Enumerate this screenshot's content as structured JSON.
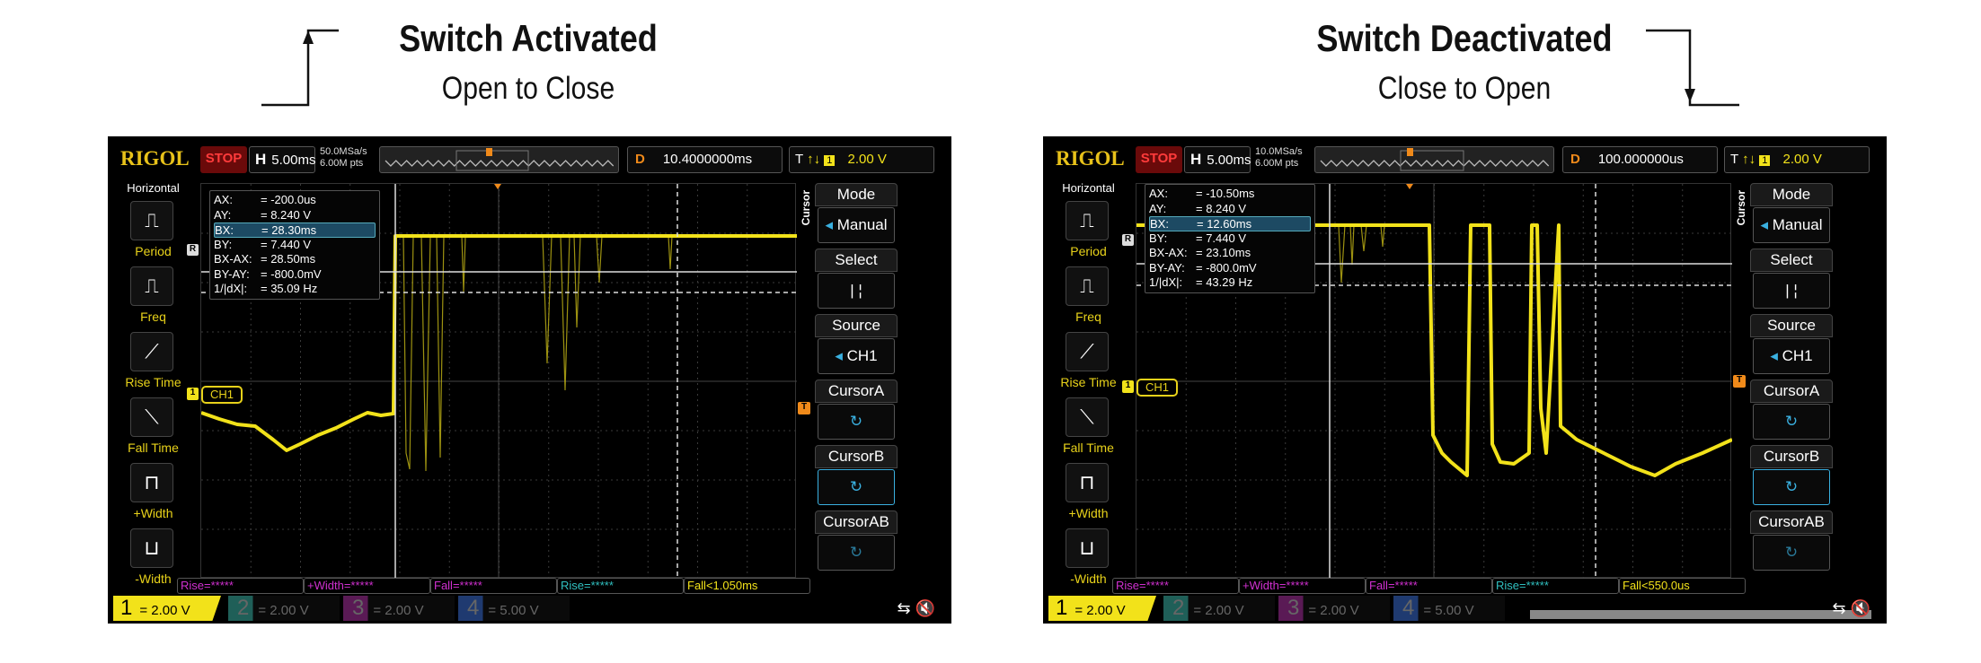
{
  "annotations": [
    {
      "title": "Switch Activated",
      "subtitle": "Open to Close",
      "arrow": "up"
    },
    {
      "title": "Switch Deactivated",
      "subtitle": "Close to Open",
      "arrow": "down"
    }
  ],
  "colors": {
    "ch1": "#f2e21a",
    "ch2": "#2a9d8f",
    "ch3": "#b0309a",
    "ch4": "#2a5db0",
    "cursor_accent": "#3ab0e0",
    "trigger": "#f08a1a",
    "stop": "#ff3b3b"
  },
  "scopes": [
    {
      "brand": "RIGOL",
      "run_state": "STOP",
      "timebase_label": "H",
      "timebase": "5.00ms",
      "sample_rate": "50.0MSa/s",
      "memory_depth": "6.00M pts",
      "delay_label": "D",
      "delay": "10.4000000ms",
      "trigger_label": "T",
      "trigger_icons": "↑↓",
      "trigger_channel": "1",
      "trigger_level": "2.00 V",
      "left_menu": {
        "title": "Horizontal",
        "items": [
          {
            "label": "Period",
            "icon": "period-icon"
          },
          {
            "label": "Freq",
            "icon": "freq-icon"
          },
          {
            "label": "Rise Time",
            "icon": "rise-time-icon"
          },
          {
            "label": "Fall Time",
            "icon": "fall-time-icon"
          },
          {
            "label": "+Width",
            "icon": "positive-width-icon"
          },
          {
            "label": "-Width",
            "icon": "negative-width-icon"
          }
        ]
      },
      "cursor_readout": [
        {
          "k": "AX:",
          "v": "= -200.0us"
        },
        {
          "k": "AY:",
          "v": "= 8.240 V"
        },
        {
          "k": "BX:",
          "v": "= 28.30ms",
          "selected": true
        },
        {
          "k": "BY:",
          "v": "= 7.440 V"
        },
        {
          "k": "BX-AX:",
          "v": "= 28.50ms"
        },
        {
          "k": "BY-AY:",
          "v": "= -800.0mV"
        },
        {
          "k": "1/|dX|:",
          "v": "= 35.09 Hz"
        }
      ],
      "right_menu": {
        "section": "Cursor",
        "mode_label": "Mode",
        "mode": "Manual",
        "select_label": "Select",
        "select": "|  ¦",
        "source_label": "Source",
        "source": "CH1",
        "cursor_a_label": "CursorA",
        "cursor_a": "-200.0us",
        "cursor_b_label": "CursorB",
        "cursor_b": "28.30ms",
        "cursor_ab_label": "CursorAB"
      },
      "channel_label": "CH1",
      "ref_marker": "R",
      "trigger_marker": "T",
      "measurements": [
        "Rise=*****",
        "+Width=*****",
        "Fall=*****",
        "Rise=*****",
        "Fall<1.050ms"
      ],
      "channels": [
        {
          "num": "1",
          "scale": "2.00 V"
        },
        {
          "num": "2",
          "scale": "2.00 V"
        },
        {
          "num": "3",
          "scale": "2.00 V"
        },
        {
          "num": "4",
          "scale": "5.00 V"
        }
      ],
      "status_icons": "⇆ 🔇"
    },
    {
      "brand": "RIGOL",
      "run_state": "STOP",
      "timebase_label": "H",
      "timebase": "5.00ms",
      "sample_rate": "10.0MSa/s",
      "memory_depth": "6.00M pts",
      "delay_label": "D",
      "delay": "100.000000us",
      "trigger_label": "T",
      "trigger_icons": "↑↓",
      "trigger_channel": "1",
      "trigger_level": "2.00 V",
      "left_menu": {
        "title": "Horizontal",
        "items": [
          {
            "label": "Period",
            "icon": "period-icon"
          },
          {
            "label": "Freq",
            "icon": "freq-icon"
          },
          {
            "label": "Rise Time",
            "icon": "rise-time-icon"
          },
          {
            "label": "Fall Time",
            "icon": "fall-time-icon"
          },
          {
            "label": "+Width",
            "icon": "positive-width-icon"
          },
          {
            "label": "-Width",
            "icon": "negative-width-icon"
          }
        ]
      },
      "cursor_readout": [
        {
          "k": "AX:",
          "v": "= -10.50ms"
        },
        {
          "k": "AY:",
          "v": "= 8.240 V"
        },
        {
          "k": "BX:",
          "v": "= 12.60ms",
          "selected": true
        },
        {
          "k": "BY:",
          "v": "= 7.440 V"
        },
        {
          "k": "BX-AX:",
          "v": "= 23.10ms"
        },
        {
          "k": "BY-AY:",
          "v": "= -800.0mV"
        },
        {
          "k": "1/|dX|:",
          "v": "= 43.29 Hz"
        }
      ],
      "right_menu": {
        "section": "Cursor",
        "mode_label": "Mode",
        "mode": "Manual",
        "select_label": "Select",
        "select": "|  ¦",
        "source_label": "Source",
        "source": "CH1",
        "cursor_a_label": "CursorA",
        "cursor_a": "-10.50ms",
        "cursor_b_label": "CursorB",
        "cursor_b": "12.60ms",
        "cursor_ab_label": "CursorAB"
      },
      "channel_label": "CH1",
      "ref_marker": "R",
      "trigger_marker": "T",
      "measurements": [
        "Rise=*****",
        "+Width=*****",
        "Fall=*****",
        "Rise=*****",
        "Fall<550.0us"
      ],
      "channels": [
        {
          "num": "1",
          "scale": "2.00 V"
        },
        {
          "num": "2",
          "scale": "2.00 V"
        },
        {
          "num": "3",
          "scale": "2.00 V"
        },
        {
          "num": "4",
          "scale": "5.00 V"
        }
      ],
      "status_icons": "⇆ 🔇"
    }
  ]
}
